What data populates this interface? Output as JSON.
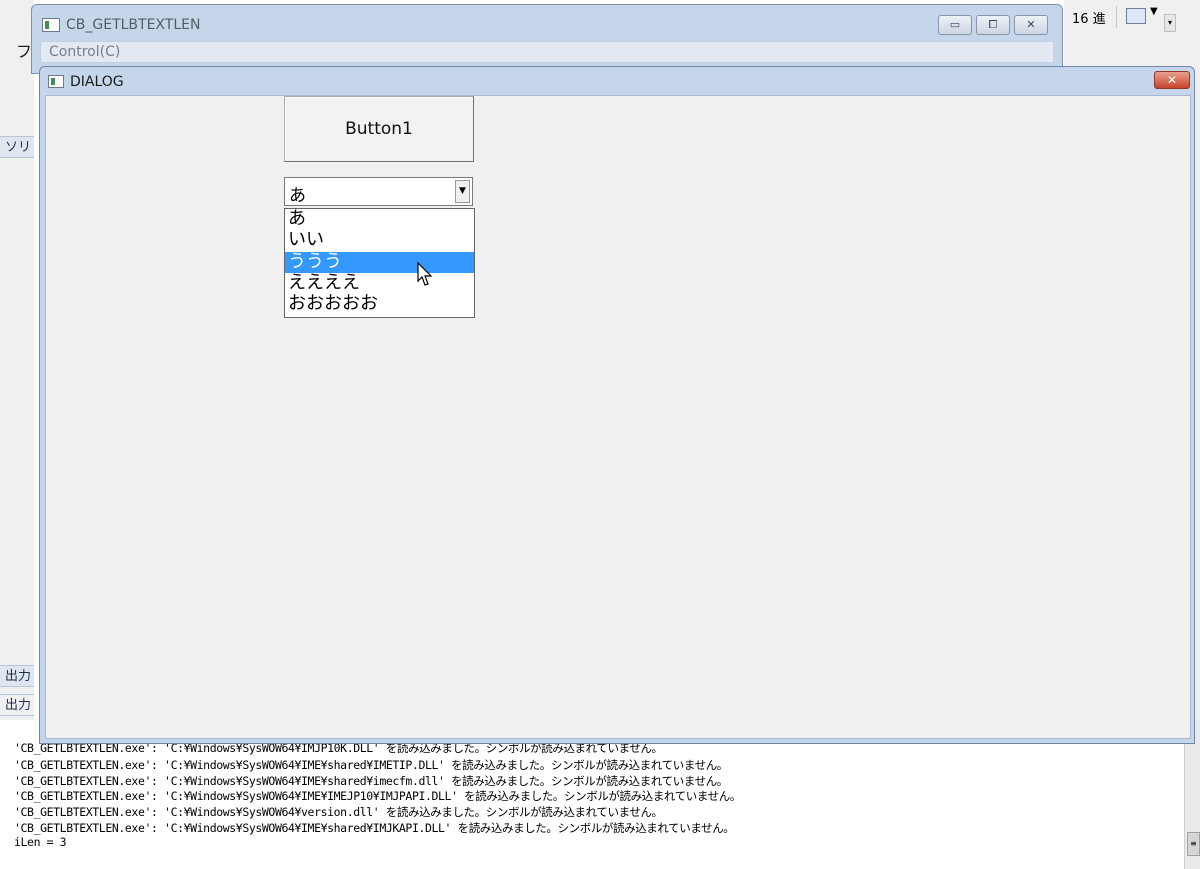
{
  "ide": {
    "left_glyph": "フ",
    "left_panel1": "ソリ",
    "left_panel2": "出力",
    "left_panel3": "出力",
    "hex_label": "16 進"
  },
  "parent_window": {
    "title": "CB_GETLBTEXTLEN",
    "menu": "Control(C)",
    "minimize": "▭",
    "maximize": "⧠",
    "close": "✕"
  },
  "dialog": {
    "title": "DIALOG",
    "close": "✕",
    "button1": "Button1",
    "combo_value": "あ",
    "combo_arrow": "▼",
    "list_items": [
      "あ",
      "いい",
      "ううう",
      "ええええ",
      "おおおおお"
    ],
    "selected_index": 2
  },
  "output": {
    "lines": [
      "'CB_GETLBTEXTLEN.exe': 'C:¥Windows¥SysWOW64¥IMJP10K.DLL' を読み込みました。シンボルが読み込まれていません。",
      "'CB_GETLBTEXTLEN.exe': 'C:¥Windows¥SysWOW64¥IME¥shared¥IMETIP.DLL' を読み込みました。シンボルが読み込まれていません。",
      "'CB_GETLBTEXTLEN.exe': 'C:¥Windows¥SysWOW64¥IME¥shared¥imecfm.dll' を読み込みました。シンボルが読み込まれていません。",
      "'CB_GETLBTEXTLEN.exe': 'C:¥Windows¥SysWOW64¥IME¥IMEJP10¥IMJPAPI.DLL' を読み込みました。シンボルが読み込まれていません。",
      "'CB_GETLBTEXTLEN.exe': 'C:¥Windows¥SysWOW64¥version.dll' を読み込みました。シンボルが読み込まれていません。",
      "'CB_GETLBTEXTLEN.exe': 'C:¥Windows¥SysWOW64¥IME¥shared¥IMJKAPI.DLL' を読み込みました。シンボルが読み込まれていません。",
      "iLen = 3"
    ]
  }
}
